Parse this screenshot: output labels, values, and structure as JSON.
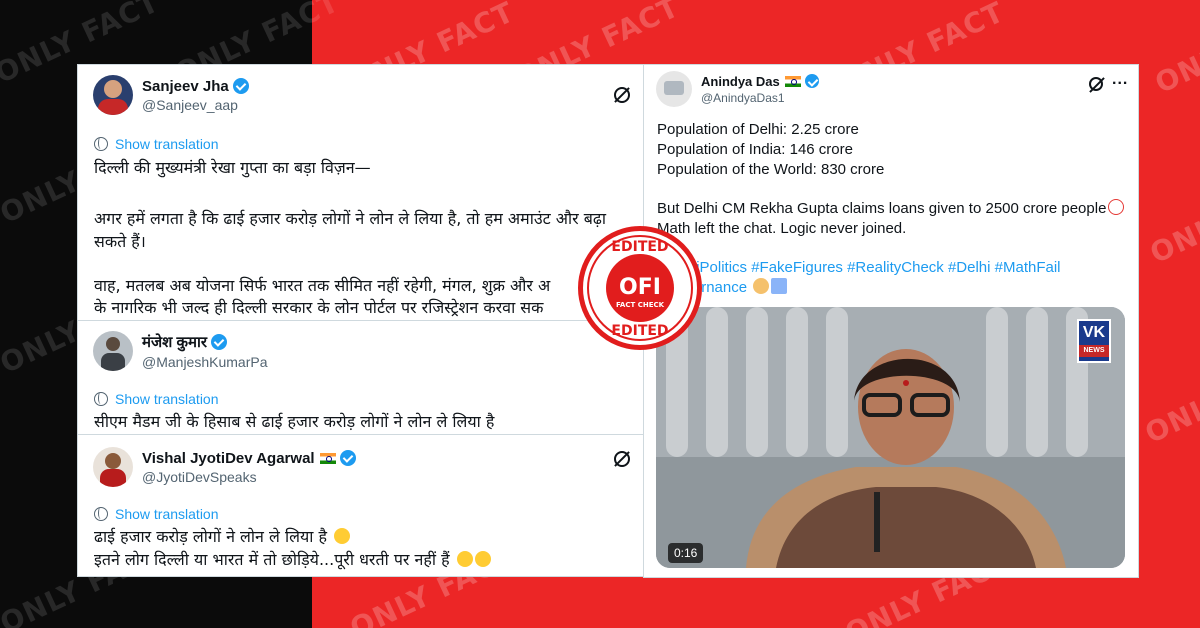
{
  "watermark": {
    "text": "ONLY FACT"
  },
  "tweets_left": [
    {
      "name": "Sanjeev Jha",
      "handle": "@Sanjeev_aap",
      "translate_label": "Show translation",
      "lines": [
        "दिल्ली की मुख्यमंत्री रेखा गुप्ता का बड़ा विज़न—",
        "",
        "अगर हमें लगता है कि ढाई हजार करोड़ लोगों ने लोन ले लिया है, तो हम अमाउंट और बढ़ा",
        "सकते हैं।",
        "",
        "वाह, मतलब अब योजना सिर्फ भारत तक सीमित नहीं रहेगी, मंगल, शुक्र और अ",
        "के नागरिक भी जल्द ही दिल्ली सरकार के लोन पोर्टल पर रजिस्ट्रेशन करवा सक"
      ]
    },
    {
      "name": "मंजेश कुमार",
      "handle": "@ManjeshKumarPa",
      "translate_label": "Show translation",
      "lines": [
        "सीएम मैडम जी के हिसाब से ढाई हजार करोड़ लोगों ने लोन ले लिया है"
      ]
    },
    {
      "name": "Vishal JyotiDev Agarwal",
      "handle": "@JyotiDevSpeaks",
      "translate_label": "Show translation",
      "lines": [
        "ढाई हजार करोड़ लोगों ने लोन ले लिया है",
        "इतने लोग दिल्ली या भारत में तो छोड़िये...पूरी धरती पर नहीं हैं"
      ]
    }
  ],
  "tweet_right": {
    "name": "Anindya Das",
    "handle": "@AnindyaDas1",
    "more_label": "...",
    "lines": [
      "Population of Delhi: 2.25 crore",
      "Population of India: 146 crore",
      "Population of the World: 830 crore",
      "",
      "But Delhi CM Rekha Gupta claims loans given to 2500 crore people",
      "Math left the chat. Logic never joined.",
      "",
      "#DelhiPolitics #FakeFigures #RealityCheck #Delhi #MathFail",
      "#Governance"
    ],
    "video_duration": "0:16",
    "video_logo": "VK",
    "video_logo_sub": "NEWS"
  },
  "stamp": {
    "top": "EDITED",
    "middle": "OFI",
    "sub": "FACT CHECK",
    "bottom": "EDITED"
  },
  "colors": {
    "accent_red": "#ec2626",
    "link_blue": "#1d9bf0",
    "verified_blue": "#1d9bf0"
  }
}
